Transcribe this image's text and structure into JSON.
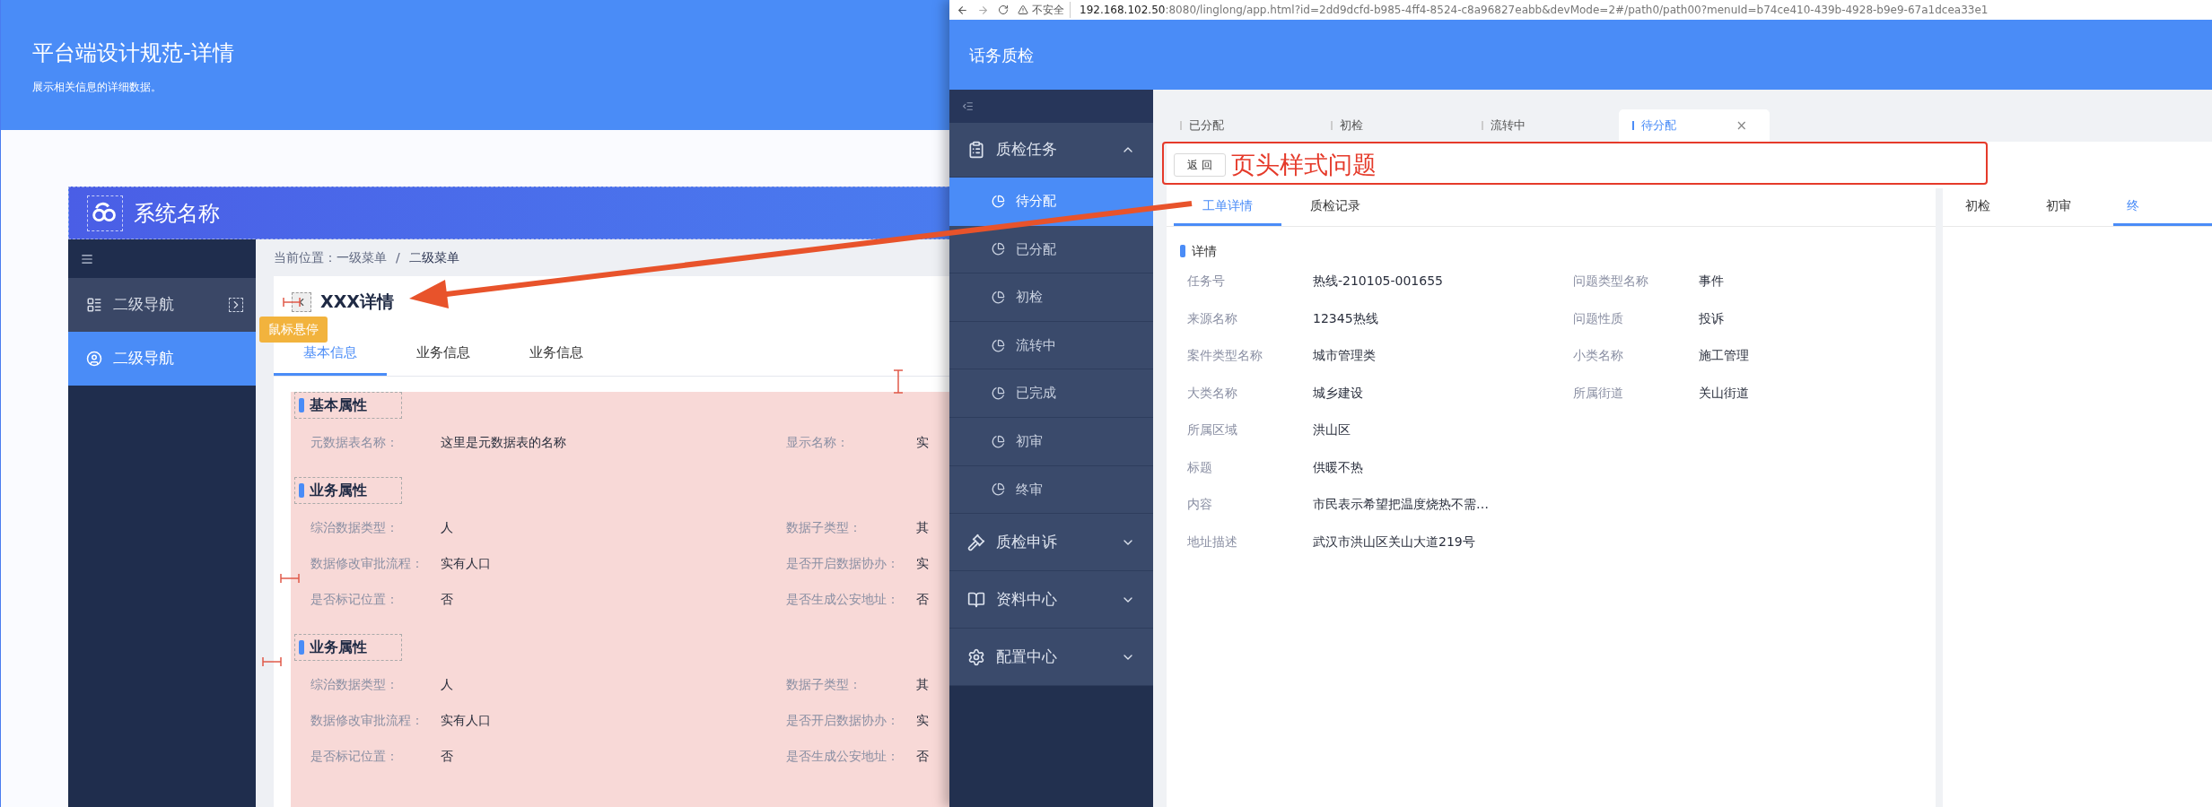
{
  "spec_page": {
    "title": "平台端设计规范-详情",
    "subtitle": "展示相关信息的详细数据。",
    "system": {
      "name": "系统名称",
      "nav": [
        {
          "label": "二级导航",
          "selected": false,
          "kind": "expandable"
        },
        {
          "label": "二级导航",
          "selected": true,
          "kind": "plain"
        }
      ],
      "breadcrumb": {
        "prefix": "当前位置：",
        "items": [
          "一级菜单",
          "二级菜单"
        ],
        "separator": "/"
      },
      "page_title": "XXX详情",
      "tooltip": "鼠标悬停",
      "tabs": [
        {
          "label": "基本信息",
          "selected": true
        },
        {
          "label": "业务信息",
          "selected": false
        },
        {
          "label": "业务信息",
          "selected": false
        }
      ],
      "sections": [
        {
          "title": "基本属性",
          "rows": [
            [
              {
                "label": "元数据表名称：",
                "value": "这里是元数据表的名称"
              },
              {
                "label": "显示名称：",
                "value": "实"
              }
            ]
          ]
        },
        {
          "title": "业务属性",
          "rows": [
            [
              {
                "label": "综治数据类型：",
                "value": "人"
              },
              {
                "label": "数据子类型：",
                "value": "其"
              }
            ],
            [
              {
                "label": "数据修改审批流程：",
                "value": "实有人口"
              },
              {
                "label": "是否开启数据协办：",
                "value": "实"
              }
            ],
            [
              {
                "label": "是否标记位置：",
                "value": "否"
              },
              {
                "label": "是否生成公安地址：",
                "value": "否"
              }
            ]
          ]
        },
        {
          "title": "业务属性",
          "rows": [
            [
              {
                "label": "综治数据类型：",
                "value": "人"
              },
              {
                "label": "数据子类型：",
                "value": "其"
              }
            ],
            [
              {
                "label": "数据修改审批流程：",
                "value": "实有人口"
              },
              {
                "label": "是否开启数据协办：",
                "value": "实"
              }
            ],
            [
              {
                "label": "是否标记位置：",
                "value": "否"
              },
              {
                "label": "是否生成公安地址：",
                "value": "否"
              }
            ]
          ]
        }
      ]
    }
  },
  "browser": {
    "insecure_label": "不安全",
    "url": "**192.168.102.50**:8080/linglong/app.html?id=2dd9dcfd-b985-4ff4-8524-c8a96827eabb&devMode=2#/path0/path00?menuId=b74ce410-439b-4928-b9e9-67a1dcea33e1",
    "app_title": "话务质检",
    "menu": [
      {
        "label": "质检任务",
        "expanded": true,
        "children": [
          {
            "label": "待分配",
            "selected": true
          },
          {
            "label": "已分配",
            "selected": false
          },
          {
            "label": "初检",
            "selected": false
          },
          {
            "label": "流转中",
            "selected": false
          },
          {
            "label": "已完成",
            "selected": false
          },
          {
            "label": "初审",
            "selected": false
          },
          {
            "label": "终审",
            "selected": false
          }
        ]
      },
      {
        "label": "质检申诉",
        "expanded": false
      },
      {
        "label": "资料中心",
        "expanded": false
      },
      {
        "label": "配置中心",
        "expanded": false
      }
    ],
    "page_tabs": [
      {
        "label": "已分配",
        "selected": false
      },
      {
        "label": "初检",
        "selected": false
      },
      {
        "label": "流转中",
        "selected": false
      },
      {
        "label": "待分配",
        "selected": true,
        "close": "×"
      }
    ],
    "back_button": "返 回",
    "annotation": "页头样式问题",
    "detail_tabs": [
      {
        "label": "工单详情",
        "selected": true
      },
      {
        "label": "质检记录",
        "selected": false
      }
    ],
    "side_tabs": [
      {
        "label": "初检",
        "selected": false
      },
      {
        "label": "初审",
        "selected": false
      },
      {
        "label": "终",
        "selected": true
      }
    ],
    "detail": {
      "title": "详情",
      "rows": [
        [
          {
            "label": "任务号",
            "value": "热线-210105-001655"
          },
          {
            "label": "问题类型名称",
            "value": "事件"
          }
        ],
        [
          {
            "label": "来源名称",
            "value": "12345热线"
          },
          {
            "label": "问题性质",
            "value": "投诉"
          }
        ],
        [
          {
            "label": "案件类型名称",
            "value": "城市管理类"
          },
          {
            "label": "小类名称",
            "value": "施工管理"
          }
        ],
        [
          {
            "label": "大类名称",
            "value": "城乡建设"
          },
          {
            "label": "所属街道",
            "value": "关山街道"
          }
        ],
        [
          {
            "label": "所属区域",
            "value": "洪山区"
          }
        ],
        [
          {
            "label": "标题",
            "value": "供暖不热"
          }
        ],
        [
          {
            "label": "内容",
            "value": "市民表示希望把温度烧热不需…"
          }
        ],
        [
          {
            "label": "地址描述",
            "value": "武汉市洪山区关山大道219号"
          }
        ]
      ]
    }
  }
}
